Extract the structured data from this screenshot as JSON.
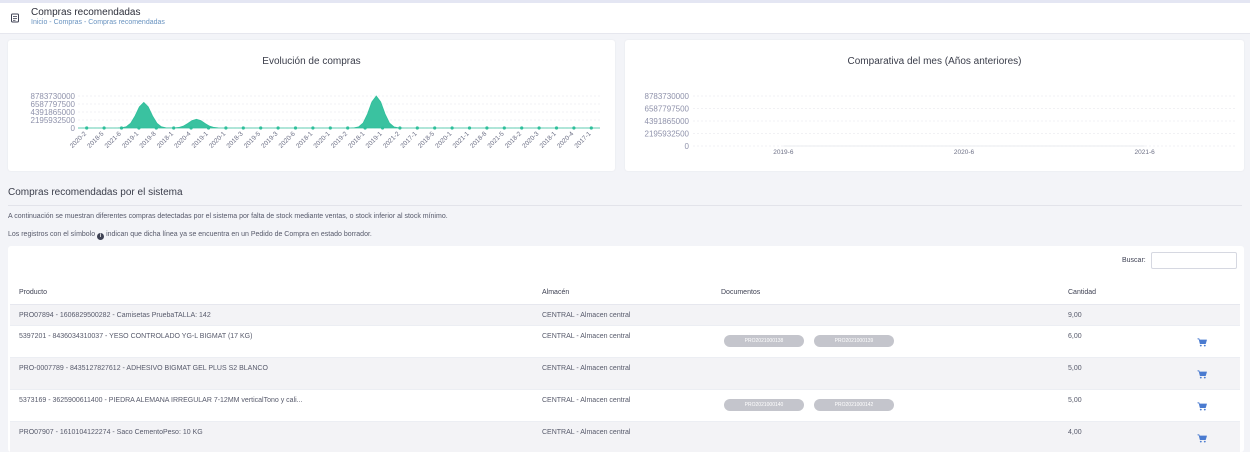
{
  "header": {
    "title": "Compras recomendadas",
    "breadcrumb": [
      "Inicio",
      "Compras",
      "Compras recomendadas"
    ],
    "separator": "-"
  },
  "chart_left": {
    "title": "Evolución de compras",
    "color": "#2fbf9b"
  },
  "chart_right": {
    "title": "Comparativa del mes (Años anteriores)"
  },
  "chart_data": [
    {
      "type": "area",
      "title": "Evolución de compras",
      "y_ticks": [
        "8783730000",
        "6587797500",
        "4391865000",
        "2195932500",
        "0"
      ],
      "ylim": [
        0,
        8783730000
      ],
      "x_tick_labels": [
        "2020-2",
        "2018-5",
        "2021-6",
        "2019-1",
        "2019-8",
        "2018-1",
        "2020-4",
        "2019-1",
        "2020-1",
        "2018-3",
        "2019-5",
        "2019-3",
        "2020-6",
        "2018-1",
        "2020-1",
        "2019-2",
        "2018-1",
        "2019-1",
        "2021-2",
        "2017-1",
        "2018-5",
        "2020-1",
        "2021-1",
        "2018-8",
        "2021-5",
        "2018-2",
        "2020-3",
        "2018-1",
        "2020-4",
        "2017-1"
      ],
      "x": [
        0,
        1,
        2,
        3,
        4,
        5,
        6,
        7,
        8,
        9,
        10,
        11,
        12,
        13,
        14,
        15,
        16,
        17,
        18,
        19,
        20,
        21,
        22,
        23,
        24,
        25,
        26,
        27,
        28,
        29,
        30,
        31,
        32,
        33,
        34,
        35,
        36,
        37,
        38,
        39,
        40,
        41,
        42,
        43,
        44,
        45,
        46,
        47,
        48,
        49,
        50,
        51,
        52,
        53,
        54,
        55,
        56,
        57,
        58,
        59,
        60,
        61,
        62,
        63,
        64,
        65,
        66,
        67,
        68,
        69,
        70,
        71,
        72,
        73,
        74,
        75,
        76,
        77,
        78,
        79,
        80,
        81,
        82,
        83,
        84,
        85,
        86,
        87,
        88,
        89,
        90,
        91,
        92,
        93,
        94,
        95,
        96,
        97,
        98,
        99,
        100,
        101,
        102,
        103,
        104,
        105,
        106,
        107,
        108,
        109,
        110,
        111,
        112,
        113,
        114,
        115,
        116,
        117,
        118,
        119
      ],
      "peaks": [
        {
          "label": "2021-6",
          "value": 7000000000
        },
        {
          "label": "2020-4",
          "value": 2400000000
        },
        {
          "label": "2020-1",
          "value": 8783730000
        }
      ],
      "grid": true,
      "legend": "none"
    },
    {
      "type": "line",
      "title": "Comparativa del mes (Años anteriores)",
      "categories": [
        "2019-6",
        "2020-6",
        "2021-6"
      ],
      "values": [
        0,
        0,
        0
      ],
      "y_ticks": [
        "8783730000",
        "6587797500",
        "4391865000",
        "2195932500",
        "0"
      ],
      "ylim": [
        0,
        8783730000
      ],
      "grid": true
    }
  ],
  "section": {
    "title": "Compras recomendadas por el sistema",
    "desc1": "A continuación se muestran diferentes compras detectadas por el sistema por falta de stock mediante ventas, o stock inferior al stock mínimo.",
    "desc2_a": "Los registros con el símbolo",
    "desc2_b": "indican que dicha línea ya se encuentra en un Pedido de Compra en estado borrador."
  },
  "search": {
    "label": "Buscar:",
    "value": ""
  },
  "table": {
    "columns": [
      "Producto",
      "Almacén",
      "Documentos",
      "Cantidad"
    ],
    "rows": [
      {
        "producto": "PRO07894 - 1606829500282 - Camisetas PruebaTALLA: 142",
        "almacen": "CENTRAL - Almacen central",
        "documentos": [],
        "cantidad": "9,00",
        "cart": false
      },
      {
        "producto": "5397201 - 8436034310037 - YESO CONTROLADO YG-L BIGMAT (17 KG)",
        "almacen": "CENTRAL - Almacen central",
        "documentos": [
          "PRO2021000138",
          "PRO2021000139"
        ],
        "cantidad": "6,00",
        "cart": true
      },
      {
        "producto": "PRO-0007789 - 8435127827612 - ADHESIVO BIGMAT GEL PLUS S2 BLANCO",
        "almacen": "CENTRAL - Almacen central",
        "documentos": [],
        "cantidad": "5,00",
        "cart": true
      },
      {
        "producto": "5373169 - 3625900611400 - PIEDRA ALEMANA IRREGULAR 7-12MM verticalTono y cali...",
        "almacen": "CENTRAL - Almacen central",
        "documentos": [
          "PRO2021000140",
          "PRO2021000142"
        ],
        "cantidad": "5,00",
        "cart": true
      },
      {
        "producto": "PRO07907 - 1610104122274 - Saco CementoPeso: 10 KG",
        "almacen": "CENTRAL - Almacen central",
        "documentos": [],
        "cantidad": "4,00",
        "cart": true
      }
    ]
  }
}
